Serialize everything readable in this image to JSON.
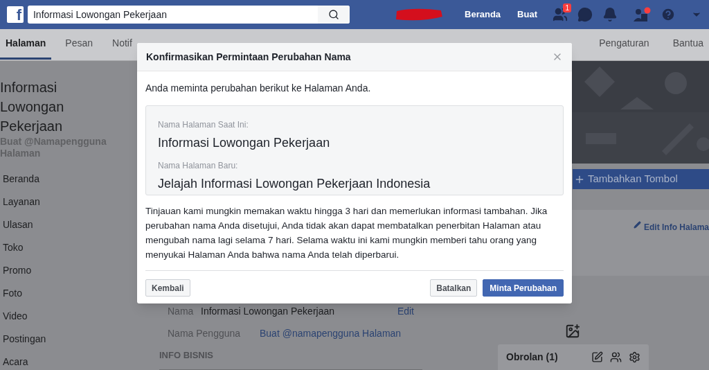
{
  "top_bar": {
    "logo": "f",
    "search": {
      "value": "Informasi Lowongan Pekerjaan"
    },
    "nav": [
      {
        "label": "Beranda"
      },
      {
        "label": "Buat"
      }
    ],
    "friends_badge": "1"
  },
  "tabs": [
    {
      "label": "Halaman",
      "selected": true
    },
    {
      "label": "Pesan",
      "selected": false
    },
    {
      "label": "Notif",
      "selected": false
    },
    {
      "label": "Pengaturan",
      "selected": false
    },
    {
      "label": "Bantua",
      "selected": false
    }
  ],
  "sidebar": {
    "title": "Informasi Lowongan Pekerjaan",
    "username_link": "Buat @Namapengguna Halaman",
    "items": [
      {
        "label": "Beranda"
      },
      {
        "label": "Layanan"
      },
      {
        "label": "Ulasan"
      },
      {
        "label": "Toko"
      },
      {
        "label": "Promo"
      },
      {
        "label": "Foto"
      },
      {
        "label": "Video"
      },
      {
        "label": "Postingan"
      },
      {
        "label": "Acara"
      }
    ]
  },
  "about": {
    "rows": [
      {
        "label": "Nama",
        "value": "Informasi Lowongan Pekerjaan",
        "action": "Edit"
      },
      {
        "label": "Nama Pengguna",
        "value": "Buat @namapengguna Halaman"
      }
    ],
    "section": "INFO BISNIS"
  },
  "right": {
    "add_button": "Tambahkan Tombol",
    "edit_info": "Edit Info Halama",
    "chat": "Obrolan (1)"
  },
  "dialog": {
    "title": "Konfirmasikan Permintaan Perubahan Nama",
    "intro": "Anda meminta perubahan berikut ke Halaman Anda.",
    "current_label": "Nama Halaman Saat Ini:",
    "current_value": "Informasi Lowongan Pekerjaan",
    "new_label": "Nama Halaman Baru:",
    "new_value": "Jelajah Informasi Lowongan Pekerjaan Indonesia",
    "notice": "Tinjauan kami mungkin memakan waktu hingga 3 hari dan memerlukan informasi tambahan. Jika perubahan nama Anda disetujui, Anda tidak akan dapat membatalkan penerbitan Halaman atau mengubah nama lagi selama 7 hari. Selama waktu ini kami mungkin memberi tahu orang yang menyukai Halaman Anda bahwa nama Anda telah diperbarui.",
    "back": "Kembali",
    "cancel": "Batalkan",
    "submit": "Minta Perubahan"
  }
}
